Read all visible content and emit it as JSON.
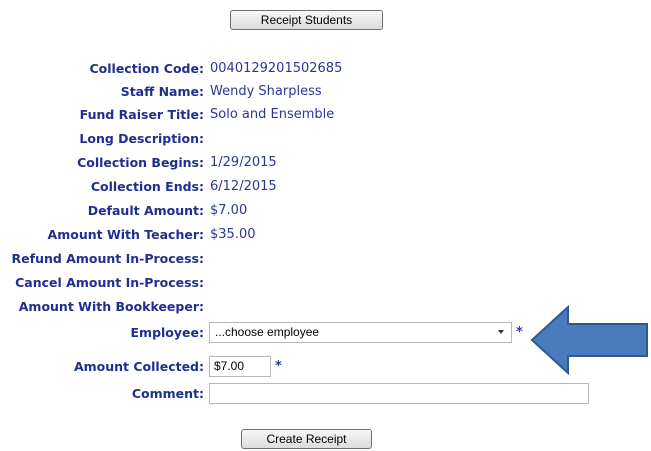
{
  "buttons": {
    "receipt_students": "Receipt Students",
    "create_receipt": "Create Receipt"
  },
  "details": [
    {
      "label": "Collection Code:",
      "value": "0040129201502685"
    },
    {
      "label": "Staff Name:",
      "value": "Wendy Sharpless"
    },
    {
      "label": "Fund Raiser Title:",
      "value": "Solo and Ensemble"
    },
    {
      "label": "Long Description:",
      "value": ""
    },
    {
      "label": "Collection Begins:",
      "value": "1/29/2015"
    },
    {
      "label": "Collection Ends:",
      "value": "6/12/2015"
    },
    {
      "label": "Default Amount:",
      "value": "$7.00"
    },
    {
      "label": "Amount With Teacher:",
      "value": "$35.00"
    },
    {
      "label": "Refund Amount In-Process:",
      "value": ""
    },
    {
      "label": "Cancel Amount In-Process:",
      "value": ""
    },
    {
      "label": "Amount With Bookkeeper:",
      "value": ""
    }
  ],
  "form": {
    "employee_label": "Employee:",
    "employee_selected": "...choose employee",
    "amount_label": "Amount Collected:",
    "amount_value": "$7.00",
    "comment_label": "Comment:",
    "comment_value": "",
    "required_marker": "*"
  },
  "colors": {
    "label": "#1f2f90",
    "value": "#2b3797",
    "arrow_fill": "#4a7bbd",
    "arrow_stroke": "#2e5a8e"
  },
  "annotation": {
    "icon": "left-arrow-icon"
  }
}
